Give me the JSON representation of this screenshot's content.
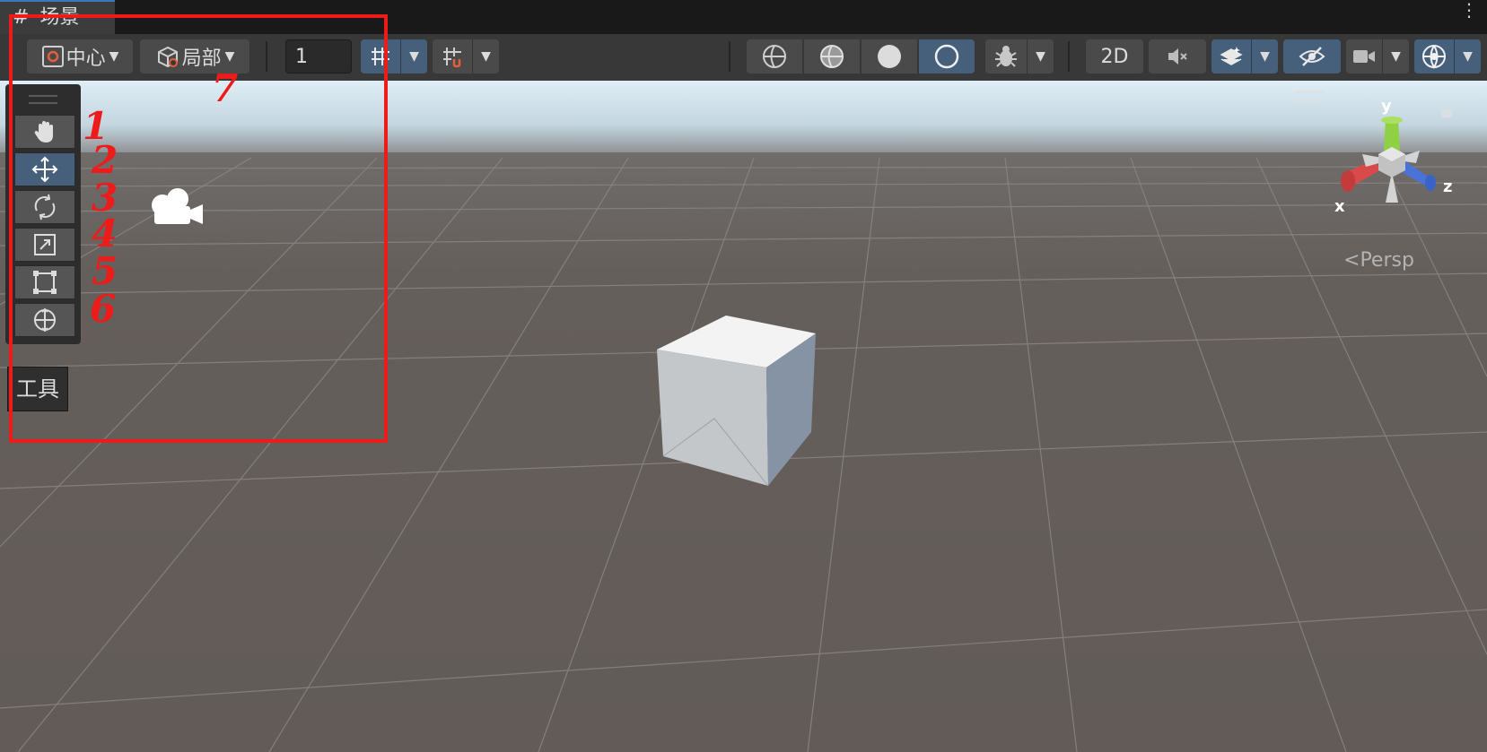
{
  "tab": {
    "icon": "grid-hash-icon",
    "title": "场景"
  },
  "toolbar": {
    "pivot_label": "中心",
    "space_label": "局部",
    "grid_size_value": "1",
    "toggle_2d_label": "2D"
  },
  "tools": [
    {
      "name": "hand-tool",
      "icon": "hand-icon",
      "active": false
    },
    {
      "name": "move-tool",
      "icon": "move-arrows-icon",
      "active": true
    },
    {
      "name": "rotate-tool",
      "icon": "rotate-icon",
      "active": false
    },
    {
      "name": "scale-tool",
      "icon": "scale-icon",
      "active": false
    },
    {
      "name": "rect-tool",
      "icon": "rect-transform-icon",
      "active": false
    },
    {
      "name": "transform-tool",
      "icon": "transform-icon",
      "active": false
    }
  ],
  "tools_label": "工具",
  "gizmo": {
    "x_label": "x",
    "y_label": "y",
    "z_label": "z",
    "projection_label": "Persp"
  },
  "annotations": {
    "numbers": [
      "1",
      "2",
      "3",
      "4",
      "5",
      "6",
      "7"
    ],
    "color": "#ee1b1b"
  },
  "colors": {
    "accent": "#46607c",
    "sky": "#c9dde8",
    "ground": "#655f5b",
    "axis_x": "#d94b4b",
    "axis_y": "#8fd045",
    "axis_z": "#4a73d8"
  }
}
